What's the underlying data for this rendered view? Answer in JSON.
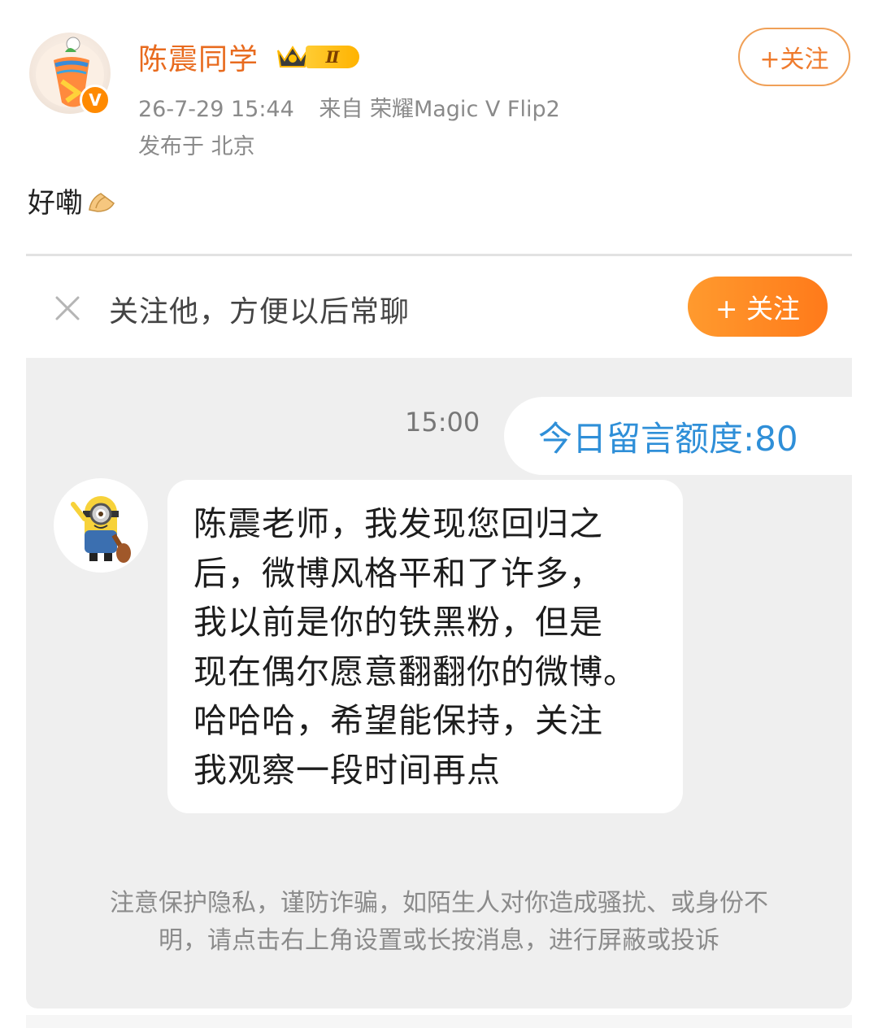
{
  "post": {
    "author": "陈震同学",
    "rank_level": "Ⅱ",
    "timestamp": "26-7-29 15:44",
    "source": "来自 荣耀Magic V Flip2",
    "location": "发布于 北京",
    "follow_label": "+关注",
    "text": "好嘞",
    "text_emoji": "hands-emoji"
  },
  "prompt": {
    "text": "关注他，方便以后常聊",
    "follow_label": "+ 关注"
  },
  "chat": {
    "time": "15:00",
    "quota_text": "今日留言额度:80",
    "message_lines": [
      "陈震老师，我发现您回归之",
      "后，微博风格平和了许多，",
      "我以前是你的铁黑粉，但是",
      "现在偶尔愿意翻翻你的微博。",
      "哈哈哈，希望能保持，关注",
      "我观察一段时间再点"
    ],
    "notice": "注意保护隐私，谨防诈骗，如陌生人对你造成骚扰、或身份不明，请点击右上角设置或长按消息，进行屏蔽或投诉"
  },
  "colors": {
    "author": "#e86b1f",
    "follow_orange": "#ff8a24",
    "quota_blue": "#2f8fd8"
  }
}
